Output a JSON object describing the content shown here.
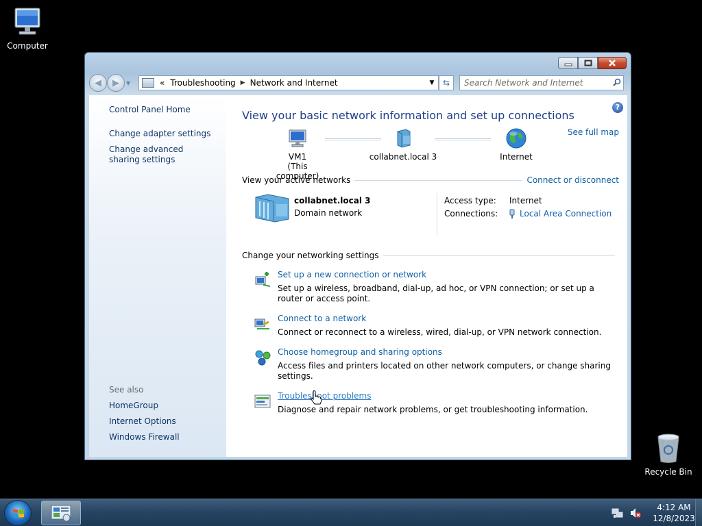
{
  "desktop": {
    "computer_label": "Computer",
    "recycle_label": "Recycle Bin"
  },
  "window": {
    "breadcrumb": [
      "Troubleshooting",
      "Network and Internet"
    ],
    "breadcrumb_overflow": "«",
    "search_placeholder": "Search Network and Internet"
  },
  "sidebar": {
    "home": "Control Panel Home",
    "items": [
      "Change adapter settings",
      "Change advanced sharing settings"
    ],
    "see_also_title": "See also",
    "see_also": [
      "HomeGroup",
      "Internet Options",
      "Windows Firewall"
    ]
  },
  "main": {
    "title": "View your basic network information and set up connections",
    "see_full_map": "See full map",
    "map_nodes": {
      "computer": "VM1",
      "computer_sub": "(This computer)",
      "domain": "collabnet.local  3",
      "internet": "Internet"
    },
    "active_networks_title": "View your active networks",
    "connect_disconnect": "Connect or disconnect",
    "active_network": {
      "name": "collabnet.local  3",
      "type": "Domain network",
      "access_label": "Access type:",
      "access_value": "Internet",
      "connections_label": "Connections:",
      "connection_value": "Local Area Connection"
    },
    "settings_title": "Change your networking settings",
    "tasks": [
      {
        "title": "Set up a new connection or network",
        "desc": "Set up a wireless, broadband, dial-up, ad hoc, or VPN connection; or set up a router or access point.",
        "icon": "new-connection-icon"
      },
      {
        "title": "Connect to a network",
        "desc": "Connect or reconnect to a wireless, wired, dial-up, or VPN network connection.",
        "icon": "connect-network-icon"
      },
      {
        "title": "Choose homegroup and sharing options",
        "desc": "Access files and printers located on other network computers, or change sharing settings.",
        "icon": "homegroup-icon"
      },
      {
        "title": "Troubleshoot problems",
        "desc": "Diagnose and repair network problems, or get troubleshooting information.",
        "icon": "troubleshoot-icon"
      }
    ]
  },
  "taskbar": {
    "time": "4:12 AM",
    "date": "12/8/2023"
  },
  "colors": {
    "link": "#0e5ea6",
    "title": "#1e3f8a",
    "sidebar_link": "#0e3465"
  }
}
